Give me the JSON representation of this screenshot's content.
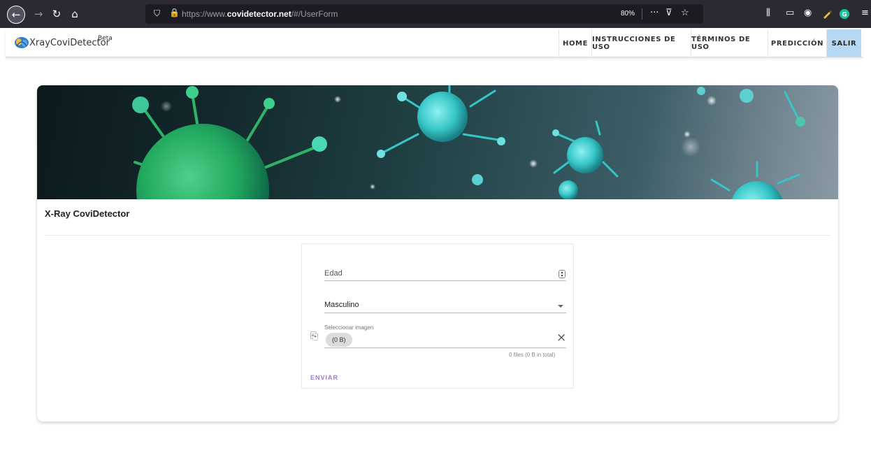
{
  "browser": {
    "url_prefix": "https://www.",
    "url_domain": "covidetector.net",
    "url_path": "/#/UserForm",
    "zoom": "80%",
    "icons": {
      "back": "arrow-left-icon",
      "forward": "arrow-right-icon",
      "reload": "reload-icon",
      "home": "home-icon",
      "shield": "shield-icon",
      "lock": "lock-icon",
      "more": "more-icon",
      "pocket": "pocket-icon",
      "bookmark": "star-icon"
    }
  },
  "header": {
    "logo_text": "XrayCoviDetector",
    "logo_sup": "Beta",
    "nav": [
      {
        "label": "HOME"
      },
      {
        "label": "INSTRUCCIONES DE USO"
      },
      {
        "label": "TÉRMINOS DE USO"
      },
      {
        "label": "PREDICCIÓN"
      },
      {
        "label": "SALIR"
      }
    ]
  },
  "card": {
    "title": "X-Ray CoviDetector"
  },
  "form": {
    "edad_label": "Edad",
    "sexo_value": "Masculino",
    "image_label": "Seleccionar imagen",
    "chip_text": "(0 B)",
    "files_text": "0 files (0 B in total)",
    "submit_label": "ENVIAR"
  },
  "colors": {
    "salir_bg": "#b6d8f2",
    "submit": "#9c7ec4",
    "virus_green": "#2fb36a",
    "virus_cyan": "#3fc9c9"
  }
}
